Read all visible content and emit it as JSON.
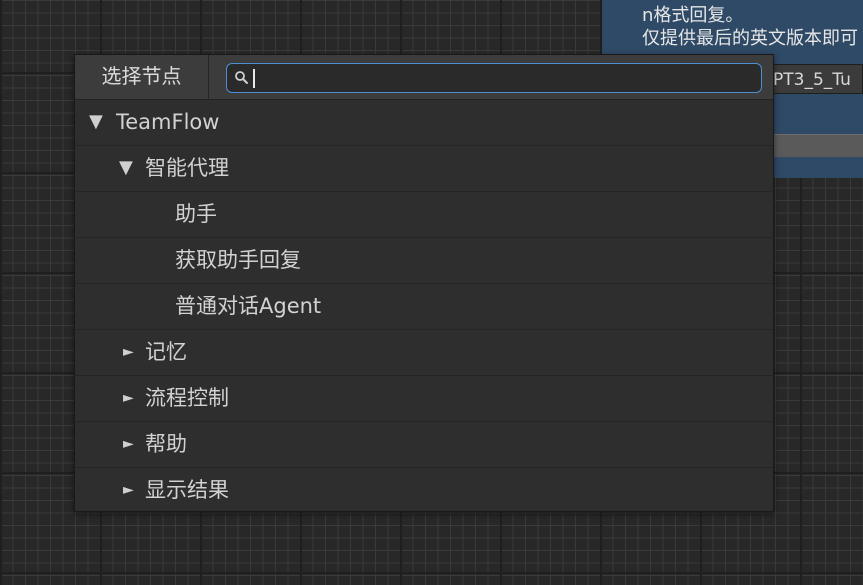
{
  "background_node": {
    "text_line1": "n格式回复。",
    "text_line2": "仅提供最后的英文版本即可",
    "field_value": "PT3_5_Tu"
  },
  "search_window": {
    "title": "选择节点",
    "search_value": "",
    "icons": {
      "search": "search-icon",
      "expanded": "triangle-down-icon",
      "collapsed": "triangle-right-icon"
    },
    "expanded_glyph": "▼",
    "collapsed_glyph": "►",
    "tree": [
      {
        "label": "TeamFlow",
        "level": 0,
        "state": "expanded"
      },
      {
        "label": "智能代理",
        "level": 1,
        "state": "expanded"
      },
      {
        "label": "助手",
        "level": 2,
        "state": "leaf"
      },
      {
        "label": "获取助手回复",
        "level": 2,
        "state": "leaf"
      },
      {
        "label": "普通对话Agent",
        "level": 2,
        "state": "leaf"
      },
      {
        "label": "记忆",
        "level": 1,
        "state": "collapsed"
      },
      {
        "label": "流程控制",
        "level": 1,
        "state": "collapsed"
      },
      {
        "label": "帮助",
        "level": 1,
        "state": "collapsed"
      },
      {
        "label": "显示结果",
        "level": 1,
        "state": "collapsed"
      }
    ]
  }
}
